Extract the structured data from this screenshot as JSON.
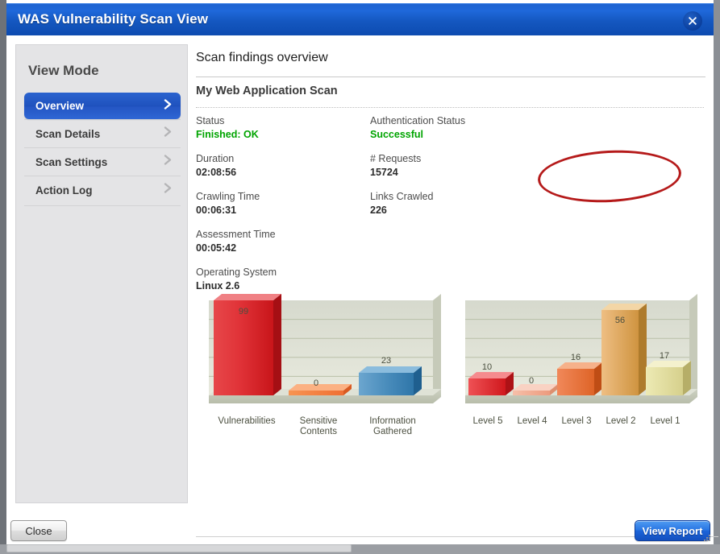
{
  "window": {
    "title": "WAS Vulnerability Scan View",
    "close_icon": "close-x-icon",
    "titlebar_color": "#1457c0"
  },
  "sidebar": {
    "title": "View Mode",
    "items": [
      {
        "label": "Overview",
        "active": true,
        "chevron_icon": "chevron-right-icon"
      },
      {
        "label": "Scan Details",
        "active": false,
        "chevron_icon": "chevron-right-icon"
      },
      {
        "label": "Scan Settings",
        "active": false,
        "chevron_icon": "chevron-right-icon"
      },
      {
        "label": "Action Log",
        "active": false,
        "chevron_icon": "chevron-right-icon"
      }
    ]
  },
  "main": {
    "header": "Scan findings overview",
    "scan_name": "My Web Application Scan",
    "fields": [
      {
        "key": "Status",
        "value": "Finished: OK",
        "status": true,
        "col": 0,
        "row": 0
      },
      {
        "key": "Authentication Status",
        "value": "Successful",
        "status": true,
        "col": 1,
        "row": 0
      },
      {
        "key": "Duration",
        "value": "02:08:56",
        "status": false,
        "col": 0,
        "row": 1
      },
      {
        "key": "# Requests",
        "value": "15724",
        "status": false,
        "col": 1,
        "row": 1
      },
      {
        "key": "Crawling Time",
        "value": "00:06:31",
        "status": false,
        "col": 0,
        "row": 2
      },
      {
        "key": "Links Crawled",
        "value": "226",
        "status": false,
        "col": 1,
        "row": 2
      },
      {
        "key": "Assessment Time",
        "value": "00:05:42",
        "status": false,
        "col": 0,
        "row": 3
      },
      {
        "key": "Operating System",
        "value": "Linux 2.6",
        "status": false,
        "col": 0,
        "row": 4
      }
    ],
    "annotation": {
      "name": "red-ellipse-highlight",
      "color": "#b51a1a",
      "targets": "Authentication Status"
    },
    "thumbnail": {
      "name": "scan-target-screenshot-thumbnail"
    }
  },
  "chart_data": [
    {
      "type": "bar",
      "name": "findings-by-category",
      "title": "",
      "categories": [
        "Vulnerabilities",
        "Sensitive Contents",
        "Information Gathered"
      ],
      "values": [
        99,
        0,
        23
      ],
      "colors": [
        "#d8262b",
        "#f0763a",
        "#3f87bd"
      ],
      "ylim": [
        0,
        110
      ],
      "grid": true,
      "xlabel": "",
      "ylabel": "",
      "legend": "none"
    },
    {
      "type": "bar",
      "name": "vulnerabilities-by-severity",
      "title": "",
      "categories": [
        "Level 5",
        "Level 4",
        "Level 3",
        "Level 2",
        "Level 1"
      ],
      "values": [
        10,
        0,
        16,
        56,
        17
      ],
      "colors": [
        "#e22a2a",
        "#f1a08a",
        "#e8702f",
        "#dfa95a",
        "#e3dea1"
      ],
      "ylim": [
        0,
        68
      ],
      "grid": true,
      "xlabel": "",
      "ylabel": "",
      "legend": "none"
    }
  ],
  "footer": {
    "close_label": "Close",
    "view_report_label": "View Report"
  }
}
